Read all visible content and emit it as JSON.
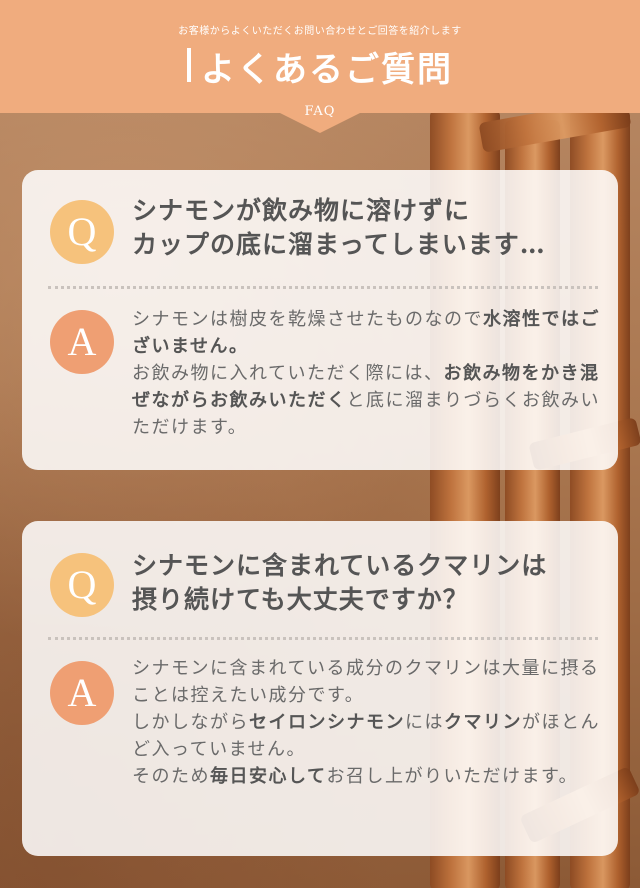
{
  "header": {
    "subtitle": "お客様からよくいただくお問い合わせとご回答を紹介します",
    "title": "よくあるご質問",
    "label": "FAQ"
  },
  "colors": {
    "header": "#f0ac7e",
    "q_circle": "#f6c27c",
    "a_circle": "#ef9f73"
  },
  "faq": [
    {
      "q_mark": "Q",
      "question_line1": "シナモンが飲み物に溶けずに",
      "question_line2": "カップの底に溜まってしまいます…",
      "a_mark": "A",
      "answer": {
        "p1": "シナモンは樹皮を乾燥させたものなので",
        "b1": "水溶性",
        "b2": "ではございません。",
        "p2": "お飲み物に入れていただく際には、",
        "b3": "お飲み物をかき混ぜながらお飲みいただく",
        "p3": "と底に溜まりづらくお飲みいただけます。"
      }
    },
    {
      "q_mark": "Q",
      "question_line1": "シナモンに含まれているクマリンは",
      "question_line2": "摂り続けても大丈夫ですか？",
      "a_mark": "A",
      "answer": {
        "p1": "シナモンに含まれている成分のクマリンは大量に摂ることは控えたい成分です。",
        "p2": "しかしながら",
        "b1": "セイロンシナモン",
        "p3": "には",
        "b2": "クマリン",
        "p4": "がほとんど入っていません。",
        "p5": "そのため",
        "b3": "毎日安心して",
        "p6": "お召し上がりいただけます。"
      }
    }
  ]
}
